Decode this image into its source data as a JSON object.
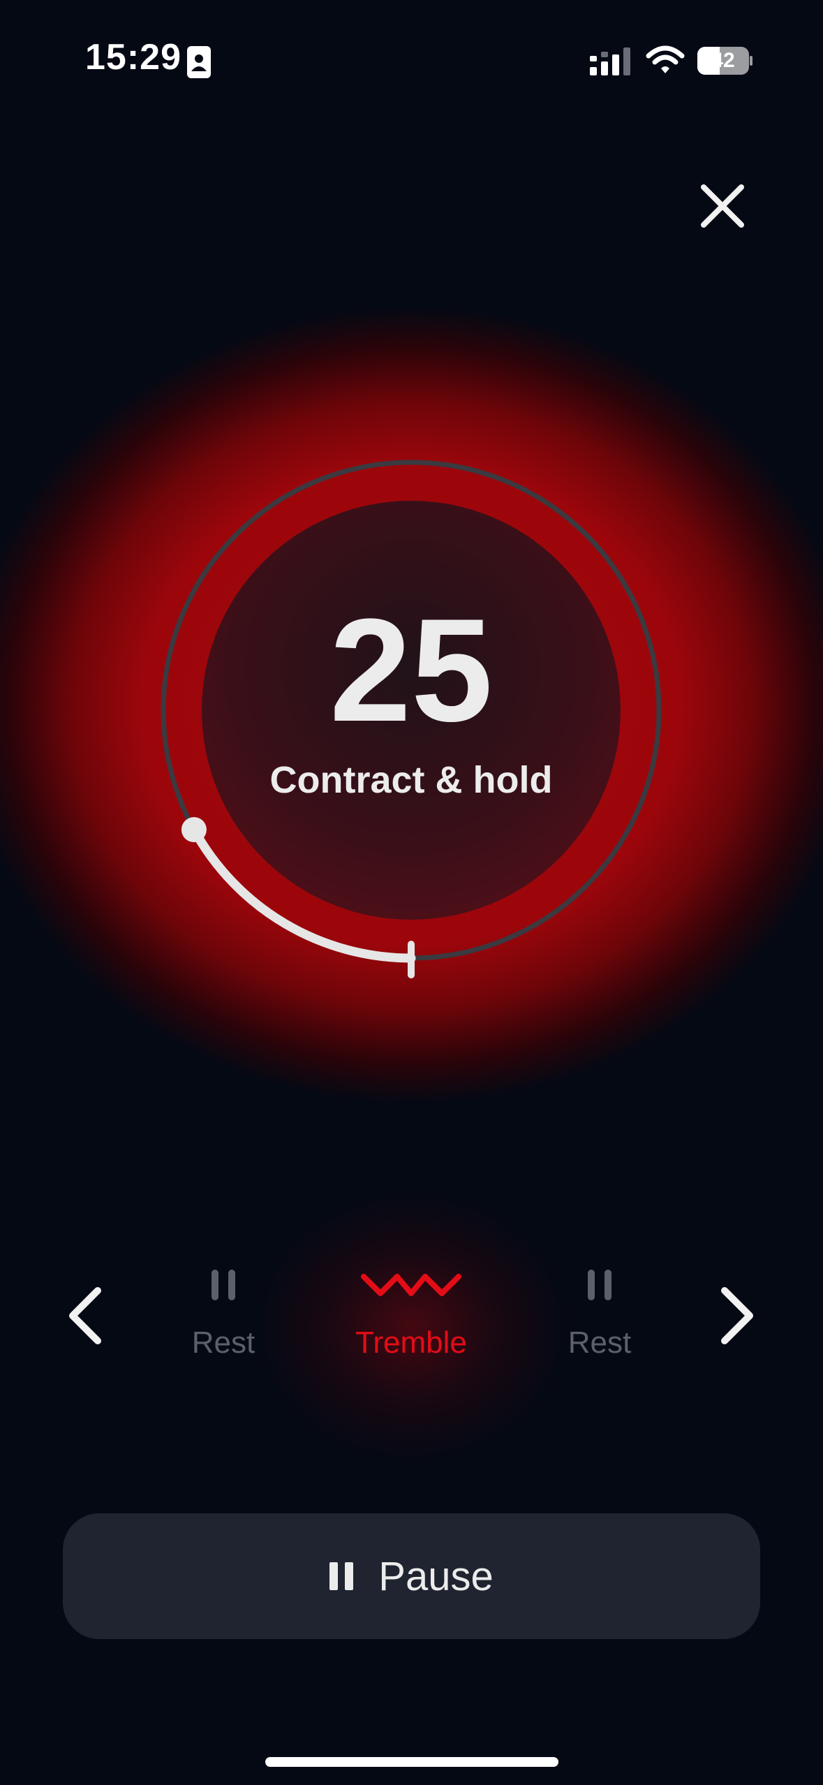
{
  "status_bar": {
    "time": "15:29",
    "battery_level": "42",
    "icons": [
      "id-card-icon",
      "signal-icon",
      "wifi-icon",
      "battery-icon"
    ]
  },
  "close": {
    "icon": "close-icon"
  },
  "timer": {
    "count": "25",
    "phase": "Contract & hold",
    "progress_fraction": 0.17,
    "colors": {
      "accent": "#9C060B",
      "ring": "#3A3A40",
      "progress": "#E6E6E6"
    }
  },
  "steps": {
    "prev_icon": "chevron-left-icon",
    "next_icon": "chevron-right-icon",
    "items": [
      {
        "label": "Rest",
        "icon": "pause-bars-icon",
        "active": false
      },
      {
        "label": "Tremble",
        "icon": "zigzag-wave-icon",
        "active": true
      },
      {
        "label": "Rest",
        "icon": "pause-bars-icon",
        "active": false
      }
    ],
    "colors": {
      "active": "#E40C16",
      "inactive": "#5C606B"
    }
  },
  "pause_button": {
    "label": "Pause",
    "icon": "pause-icon"
  }
}
